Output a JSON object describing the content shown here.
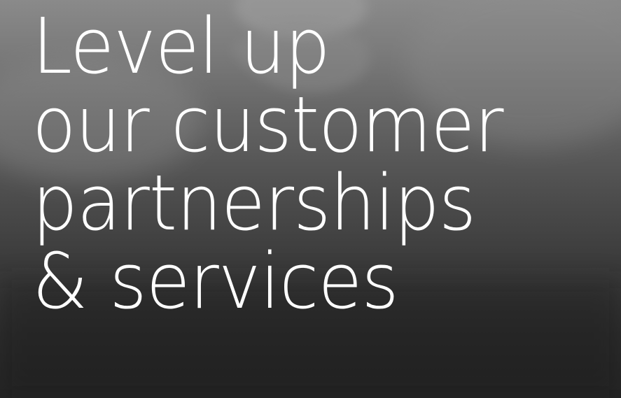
{
  "hero": {
    "headline_lines": [
      "Level up",
      "our customer",
      "partnerships",
      "& services"
    ],
    "colors": {
      "text": "#ffffff",
      "background_top": "#8a8a8a",
      "background_bottom": "#232323"
    }
  }
}
